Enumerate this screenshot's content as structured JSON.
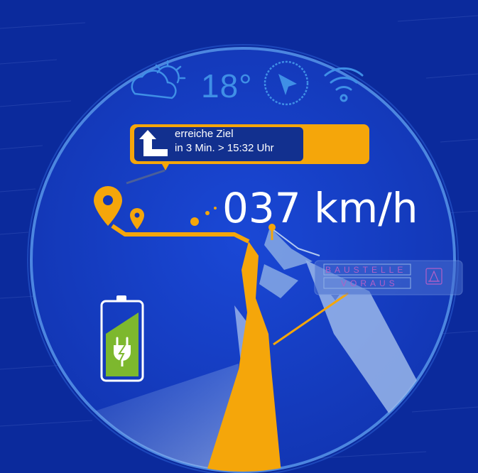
{
  "status_bar": {
    "weather_icon": "partly-cloudy-icon",
    "temperature": "18°",
    "compass_icon": "compass-icon",
    "wifi_icon": "wifi-icon"
  },
  "navigation": {
    "turn_icon": "turn-left-arrow-icon",
    "line1": "erreiche Ziel",
    "line2": "in 3 Min. > 15:32 Uhr"
  },
  "speed": {
    "value": "037 km/h"
  },
  "warning": {
    "line1": "BAUSTELLE",
    "line2": "VORAUS",
    "icon": "construction-cone-icon"
  },
  "battery": {
    "icon": "battery-charging-icon",
    "level": 0.62
  },
  "colors": {
    "background": "#0b2a9c",
    "dial": "#1540c8",
    "accent_orange": "#f5a60a",
    "accent_blue": "#3f8fe6",
    "battery_green": "#7db82e",
    "road_light": "#a9c6ee"
  }
}
